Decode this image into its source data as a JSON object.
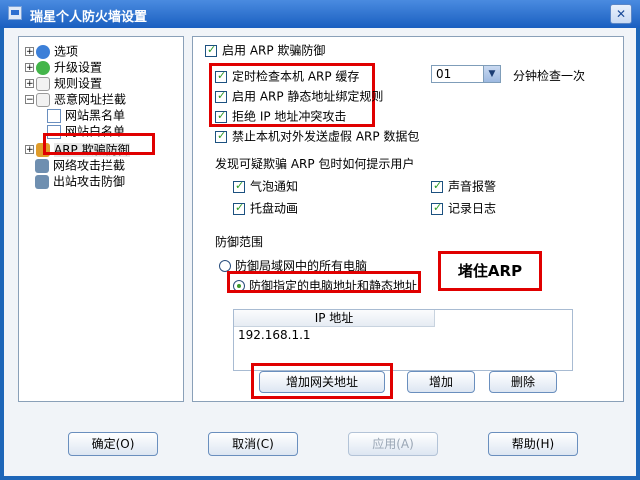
{
  "window": {
    "title": "瑞星个人防火墙设置",
    "close_glyph": "✕",
    "colors": {
      "accent": "#1a5fc0",
      "highlight": "#e00000"
    }
  },
  "tree": {
    "items": [
      {
        "label": "选项",
        "icon": "globe-icon",
        "expander": "+"
      },
      {
        "label": "升级设置",
        "icon": "update-icon",
        "expander": "+"
      },
      {
        "label": "规则设置",
        "icon": "rules-icon",
        "expander": "+"
      },
      {
        "label": "恶意网址拦截",
        "icon": "calendar-icon",
        "expander": "−"
      },
      {
        "label": "网站黑名单",
        "icon": "document-icon"
      },
      {
        "label": "网站白名单",
        "icon": "document-icon"
      },
      {
        "label": "ARP 欺骗防御",
        "icon": "shield-icon",
        "expander": "+",
        "selected": true
      },
      {
        "label": "网络攻击拦截",
        "icon": "network-icon"
      },
      {
        "label": "出站攻击防御",
        "icon": "outbound-icon"
      }
    ]
  },
  "panel": {
    "enable": {
      "label": "启用 ARP 欺骗防御",
      "checked": true
    },
    "opt1": {
      "label": "定时检查本机 ARP 缓存",
      "checked": true
    },
    "interval": {
      "value": "01",
      "suffix": "分钟检查一次",
      "arrow": "▼"
    },
    "opt2": {
      "label": "启用 ARP 静态地址绑定规则",
      "checked": true
    },
    "opt3": {
      "label": "拒绝 IP 地址冲突攻击",
      "checked": true
    },
    "opt4": {
      "label": "禁止本机对外发送虚假 ARP 数据包",
      "checked": true
    },
    "notify_heading": "发现可疑欺骗 ARP 包时如何提示用户",
    "notify": [
      {
        "label": "气泡通知",
        "checked": true
      },
      {
        "label": "声音报警",
        "checked": true
      },
      {
        "label": "托盘动画",
        "checked": true
      },
      {
        "label": "记录日志",
        "checked": true
      }
    ],
    "defense_heading": "防御范围",
    "radio1": {
      "label": "防御局域网中的所有电脑",
      "selected": false
    },
    "radio2": {
      "label": "防御指定的电脑地址和静态地址",
      "selected": true
    },
    "ip_table": {
      "header": "IP 地址",
      "rows": [
        "192.168.1.1"
      ]
    },
    "buttons": {
      "add_gateway": "增加网关地址",
      "add": "增加",
      "delete": "删除"
    },
    "annotation": "堵住ARP",
    "check_glyph": "✓"
  },
  "footer": {
    "ok": "确定(O)",
    "cancel": "取消(C)",
    "apply": "应用(A)",
    "help": "帮助(H)"
  }
}
